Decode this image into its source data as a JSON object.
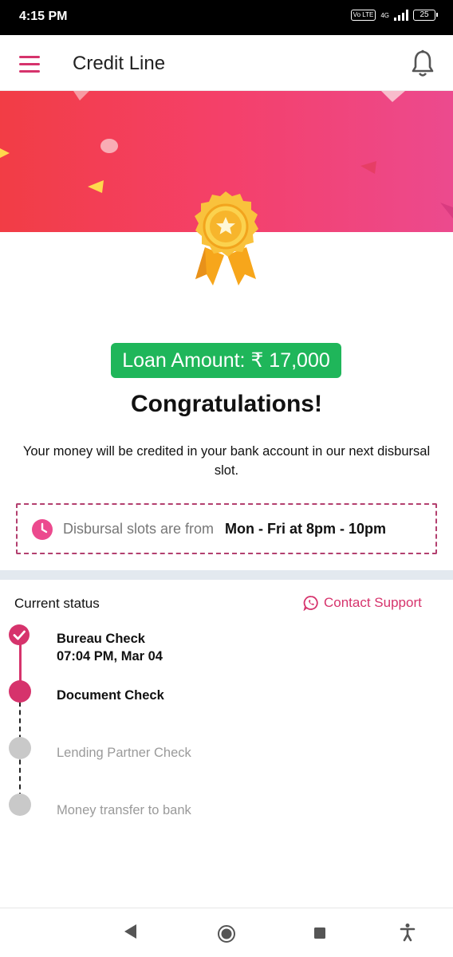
{
  "status_bar": {
    "time": "4:15 PM",
    "volte": "Vo LTE",
    "network": "4G",
    "battery": "25"
  },
  "header": {
    "title": "Credit Line"
  },
  "loan": {
    "badge": "Loan Amount: ₹ 17,000"
  },
  "message": {
    "title": "Congratulations!",
    "body": "Your money will be credited in your bank account in our next disbursal slot."
  },
  "disbursal": {
    "label": "Disbursal slots are from",
    "slots": "Mon - Fri at 8pm - 10pm"
  },
  "status": {
    "title": "Current status",
    "contact_label": "Contact Support",
    "steps": [
      {
        "label": "Bureau Check",
        "time": "07:04 PM, Mar 04",
        "state": "done"
      },
      {
        "label": "Document Check",
        "state": "active"
      },
      {
        "label": "Lending Partner Check",
        "state": "pending"
      },
      {
        "label": "Money transfer to bank",
        "state": "pending"
      }
    ]
  },
  "colors": {
    "accent": "#d6336c",
    "success": "#1fb65a",
    "banner_start": "#f23d45",
    "banner_end": "#ec4a8e"
  },
  "icons": [
    "menu-icon",
    "bell-icon",
    "medal-icon",
    "clock-icon",
    "whatsapp-icon",
    "check-icon",
    "back-icon",
    "home-icon",
    "recents-icon",
    "accessibility-icon"
  ]
}
